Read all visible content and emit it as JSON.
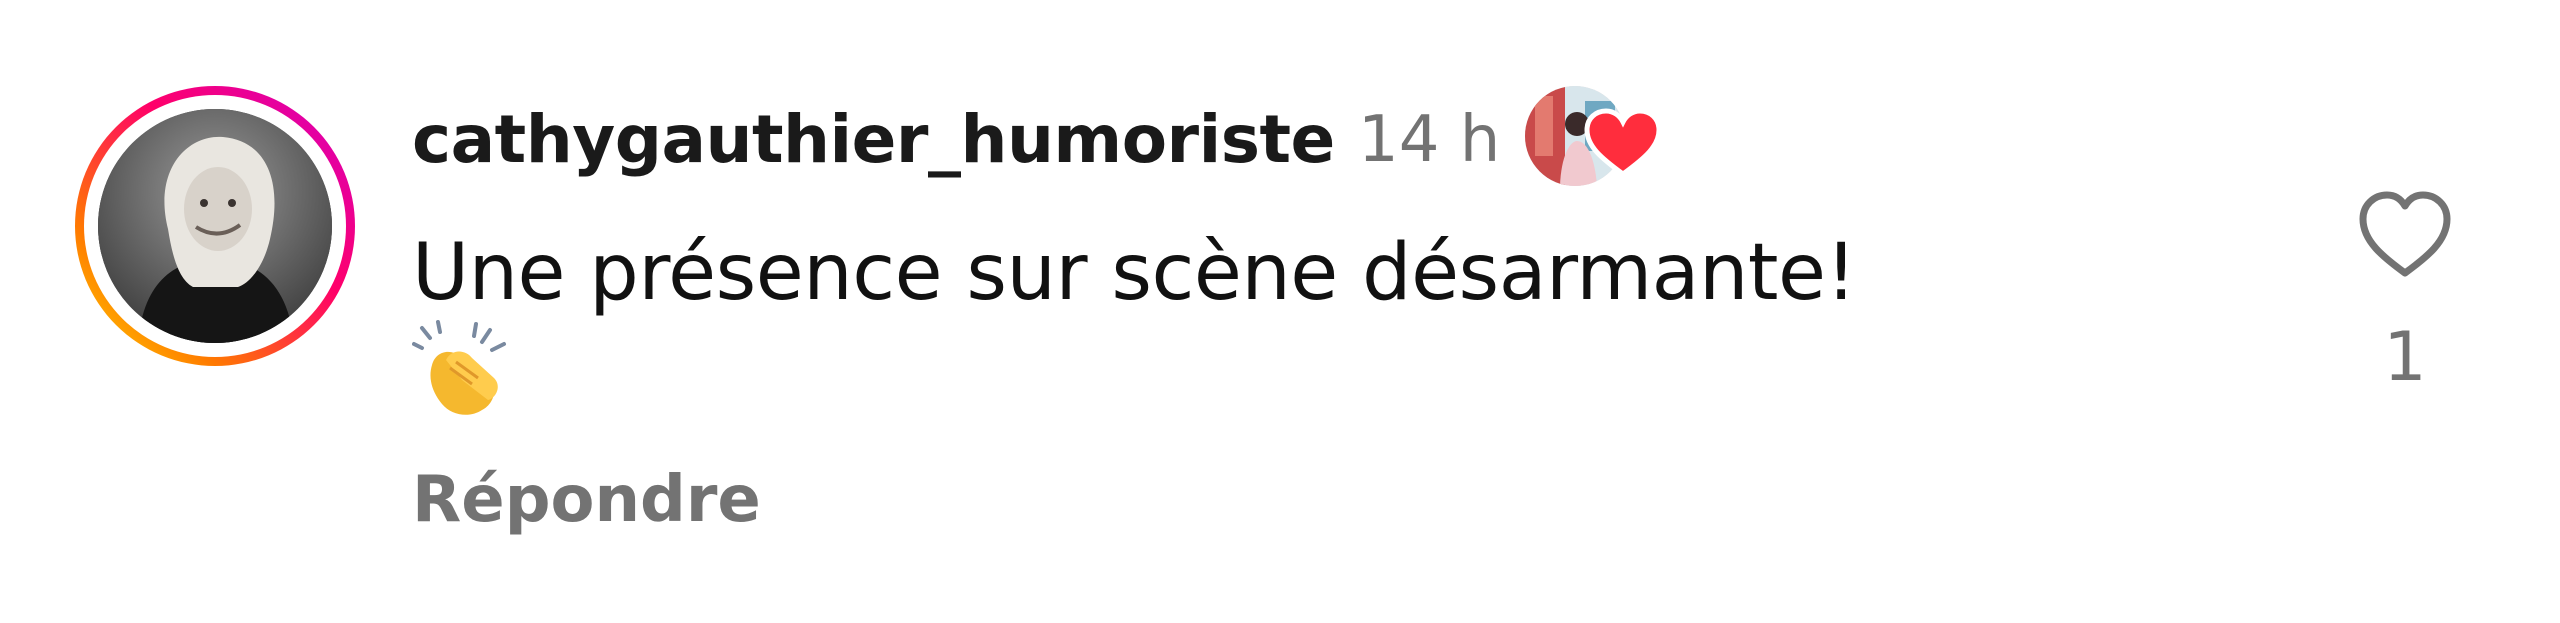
{
  "comment": {
    "author": {
      "username": "cathygauthier_humoriste",
      "avatar_icon": "profile-photo-avatar",
      "has_story_ring": true
    },
    "timestamp": "14 h",
    "liked_by_creator_icon": "creator-liked-heart-icon",
    "text": "Une présence sur scène désarmante!",
    "emoji": "clapping-hands-emoji",
    "reply_label": "Répondre",
    "like_icon": "heart-outline-icon",
    "like_count": "1"
  },
  "colors": {
    "text_primary": "#111111",
    "text_secondary": "#737373",
    "heart_red": "#ff2d3d",
    "ring_gradient": [
      "#d300c5",
      "#ff0069",
      "#ff7a00",
      "#ffd600"
    ]
  }
}
